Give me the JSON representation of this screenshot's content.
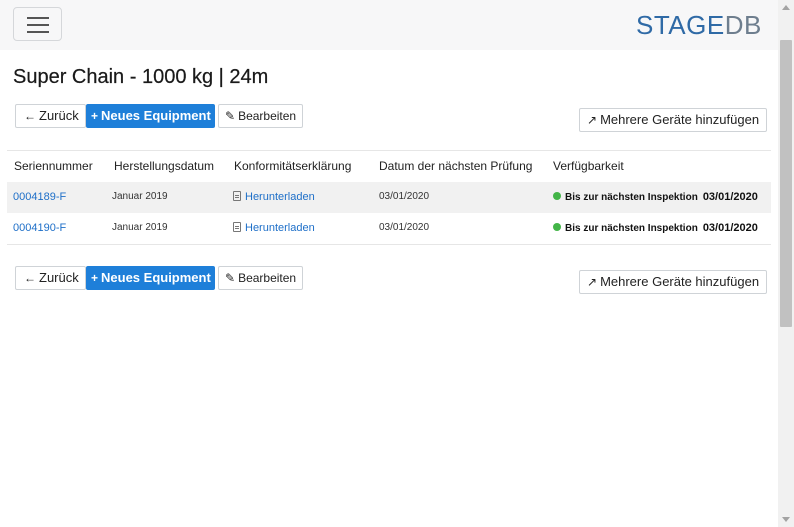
{
  "brand": {
    "part1": "STAGE",
    "part2": "DB"
  },
  "page_title": "Super Chain - 1000 kg | 24m",
  "toolbar": {
    "back_label": "Zurück",
    "new_label": "Neues Equipment",
    "edit_label": "Bearbeiten",
    "multi_label": "Mehrere Geräte hinzufügen"
  },
  "table": {
    "headers": [
      "Seriennummer",
      "Herstellungsdatum",
      "Konformitätserklärung",
      "Datum der nächsten Prüfung",
      "Verfügbarkeit"
    ],
    "rows": [
      {
        "serial": "0004189-F",
        "manufactured": "Januar 2019",
        "conformity": "Herunterladen",
        "next_check": "03/01/2020",
        "availability": "Bis zur nächsten Inspektion",
        "availability_date": "03/01/2020"
      },
      {
        "serial": "0004190-F",
        "manufactured": "Januar 2019",
        "conformity": "Herunterladen",
        "next_check": "03/01/2020",
        "availability": "Bis zur nächsten Inspektion",
        "availability_date": "03/01/2020"
      }
    ]
  },
  "colors": {
    "primary": "#1e7fd9",
    "link": "#1e6fc8",
    "available": "#43b548",
    "logo_primary": "#2f6aa6",
    "logo_secondary": "#6e7e8e"
  },
  "icons": {
    "back": "arrow-left-icon",
    "new": "plus-icon",
    "edit": "pencil-icon",
    "multi": "magic-wand-icon",
    "pdf": "file-pdf-icon",
    "status": "status-dot-icon"
  }
}
